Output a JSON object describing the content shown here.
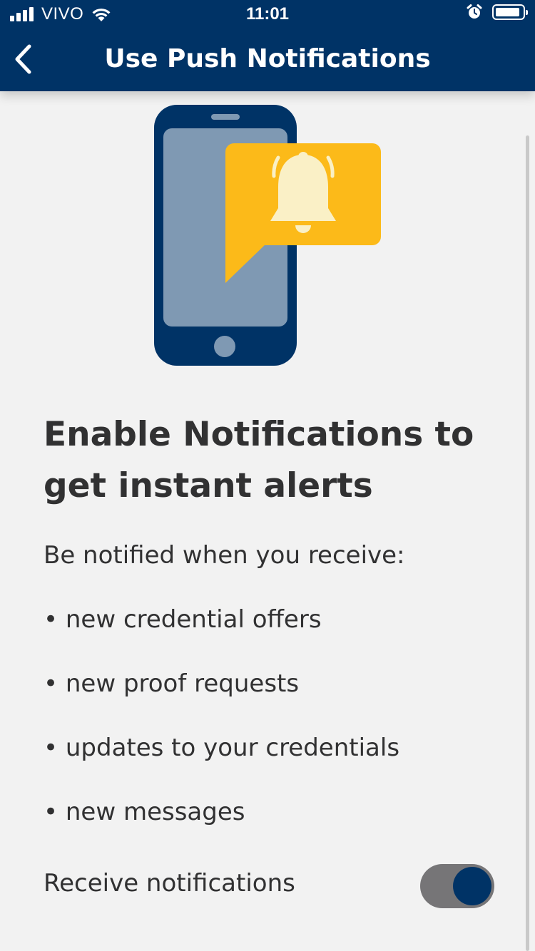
{
  "status_bar": {
    "carrier": "VIVO",
    "time": "11:01"
  },
  "header": {
    "title": "Use Push Notifications",
    "back_icon": "chevron-left-icon",
    "background_color": "#003366"
  },
  "illustration": {
    "phone_icon": "phone-icon",
    "bell_icon": "bell-icon",
    "phone_color": "#003366",
    "bubble_color": "#fcba19"
  },
  "content": {
    "heading": "Enable Notifications to get instant alerts",
    "intro": "Be notified when you receive:",
    "bullets": [
      "• new credential offers",
      "• new proof requests",
      "• updates to your credentials",
      "• new messages"
    ]
  },
  "toggle": {
    "label": "Receive notifications",
    "enabled": true,
    "knob_color": "#003366",
    "track_color": "#767577"
  }
}
